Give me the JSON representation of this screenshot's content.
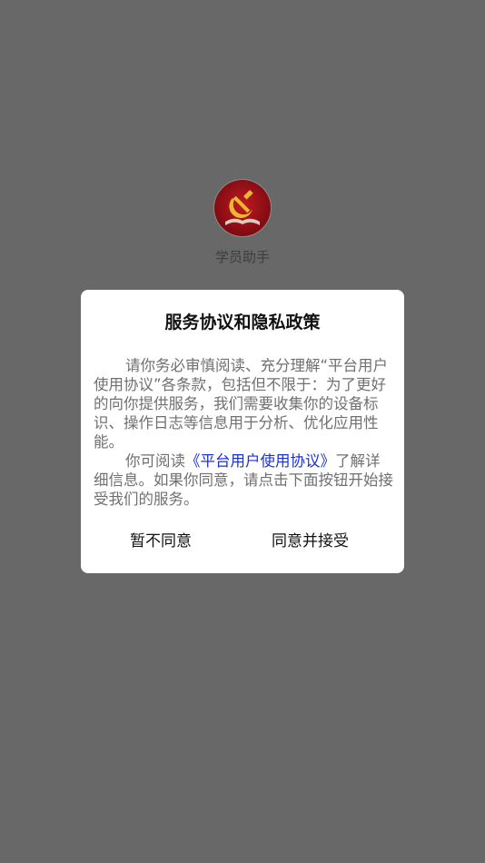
{
  "app": {
    "name": "学员助手",
    "logo_icon": "party-emblem-icon"
  },
  "dialog": {
    "title": "服务协议和隐私政策",
    "paragraph1": "请你务必审慎阅读、充分理解“平台用户使用协议”各条款，包括但不限于：为了更好的向你提供服务，我们需要收集你的设备标识、操作日志等信息用于分析、优化应用性能。",
    "paragraph2_prefix": "你可阅读",
    "agreement_link": "《平台用户使用协议》",
    "paragraph2_suffix": "了解详细信息。如果你同意，请点击下面按钮开始接受我们的服务。",
    "decline_label": "暂不同意",
    "accept_label": "同意并接受"
  },
  "colors": {
    "overlay": "#686868",
    "link": "#1a2fd6",
    "emblem_red": "#a2121b",
    "emblem_gold": "#e8b830"
  }
}
